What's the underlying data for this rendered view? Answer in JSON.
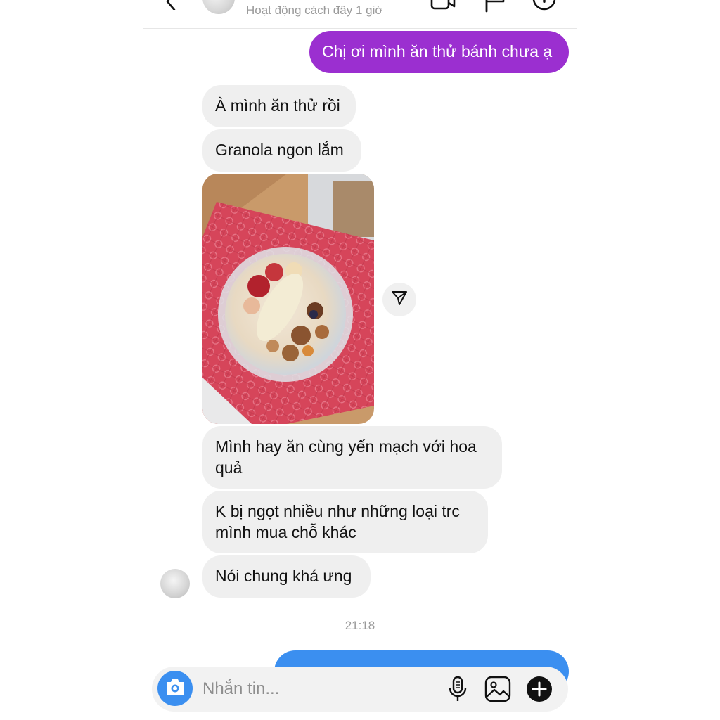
{
  "header": {
    "status": "Hoạt động cách đây 1 giờ"
  },
  "messages": {
    "m1": "Chị ơi mình ăn thử bánh chưa ạ",
    "m2": "À mình ăn thử rồi",
    "m3": "Granola ngon lắm",
    "m4": "Mình hay ăn cùng yến mạch với hoa quả",
    "m5": "K bị ngọt nhiều như những loại trc mình mua chỗ khác",
    "m6": "Nói chung khá ưng"
  },
  "timestamp": "21:18",
  "composer": {
    "placeholder": "Nhắn tin..."
  },
  "colors": {
    "outgoing_bubble": "#9b2fd0",
    "outgoing_bubble_blue": "#3b8ff0",
    "incoming_bubble": "#efefef",
    "accent": "#3b8ff0"
  },
  "icons": [
    "back-icon",
    "video-call-icon",
    "flag-icon",
    "info-icon",
    "send-icon",
    "camera-icon",
    "microphone-icon",
    "gallery-icon",
    "add-icon"
  ]
}
